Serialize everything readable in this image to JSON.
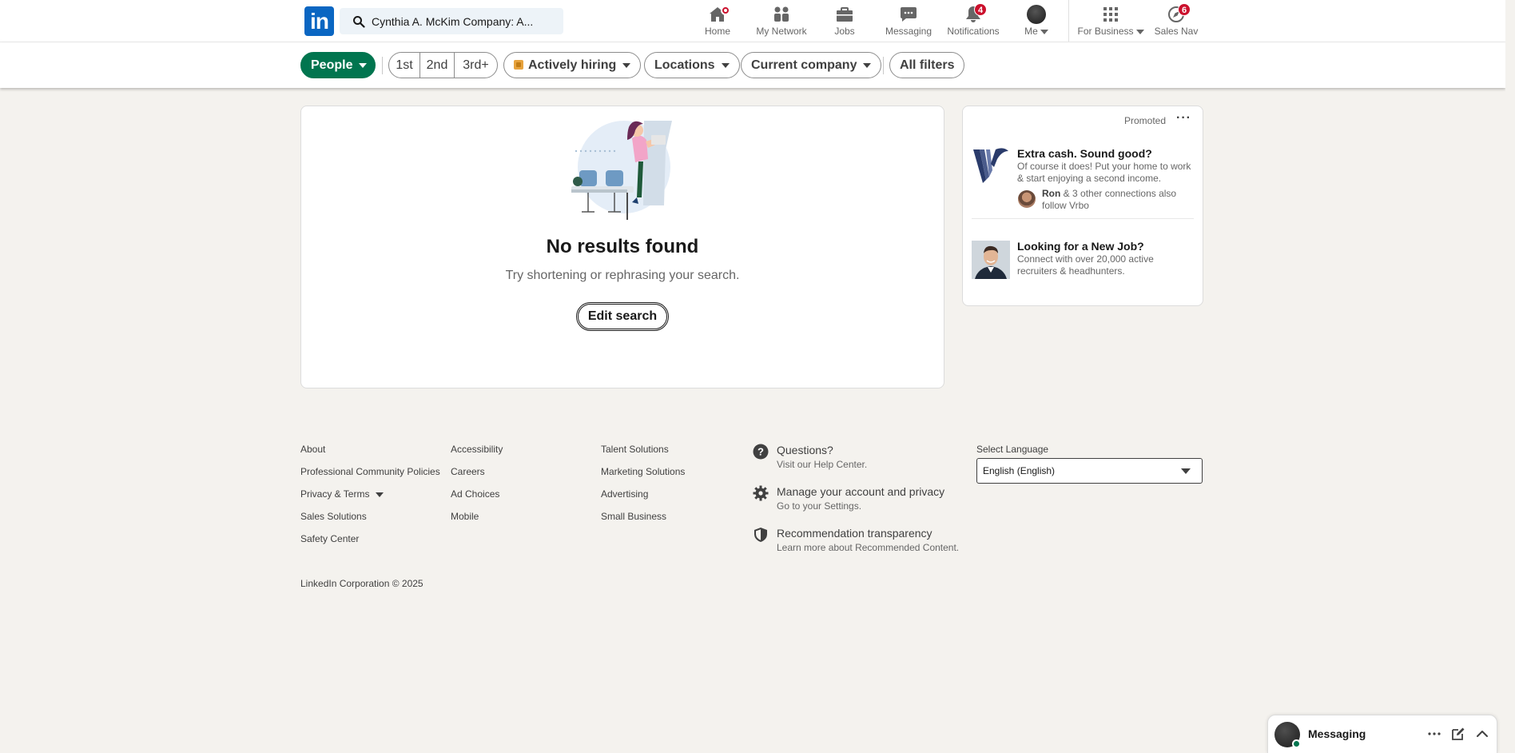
{
  "header": {
    "logo_text": "in",
    "search_value": "Cynthia A. McKim Company: A...",
    "nav": [
      {
        "label": "Home",
        "icon": "home-icon"
      },
      {
        "label": "My Network",
        "icon": "network-icon"
      },
      {
        "label": "Jobs",
        "icon": "briefcase-icon"
      },
      {
        "label": "Messaging",
        "icon": "messaging-icon"
      },
      {
        "label": "Notifications",
        "icon": "bell-icon",
        "badge": "4"
      },
      {
        "label": "Me",
        "icon": "avatar"
      },
      {
        "label": "For Business",
        "icon": "grid-icon"
      },
      {
        "label": "Sales Nav",
        "icon": "compass-icon",
        "badge": "6"
      }
    ]
  },
  "filters": {
    "people": "People",
    "degrees": [
      "1st",
      "2nd",
      "3rd+"
    ],
    "actively_hiring": "Actively hiring",
    "locations": "Locations",
    "current_company": "Current company",
    "all_filters": "All filters"
  },
  "results": {
    "title": "No results found",
    "subtitle": "Try shortening or rephrasing your search.",
    "edit_button": "Edit search"
  },
  "ads": {
    "promoted": "Promoted",
    "items": [
      {
        "title": "Extra cash. Sound good?",
        "text": "Of course it does! Put your home to work & start enjoying a second income.",
        "follow_name": "Ron",
        "follow_text": "& 3 other connections also follow Vrbo"
      },
      {
        "title": "Looking for a New Job?",
        "text": "Connect with over 20,000 active recruiters & headhunters."
      }
    ]
  },
  "footer": {
    "col1": [
      "About",
      "Professional Community Policies",
      "Privacy & Terms",
      "Sales Solutions",
      "Safety Center"
    ],
    "col2": [
      "Accessibility",
      "Careers",
      "Ad Choices",
      "Mobile"
    ],
    "col3": [
      "Talent Solutions",
      "Marketing Solutions",
      "Advertising",
      "Small Business"
    ],
    "help": [
      {
        "title": "Questions?",
        "sub": "Visit our Help Center."
      },
      {
        "title": "Manage your account and privacy",
        "sub": "Go to your Settings."
      },
      {
        "title": "Recommendation transparency",
        "sub": "Learn more about Recommended Content."
      }
    ],
    "language_label": "Select Language",
    "language_value": "English (English)",
    "copyright": "LinkedIn Corporation © 2025"
  },
  "messaging": {
    "label": "Messaging"
  },
  "colors": {
    "brand": "#0a66c2",
    "people_pill": "#01754f",
    "badge": "#cb112d"
  }
}
